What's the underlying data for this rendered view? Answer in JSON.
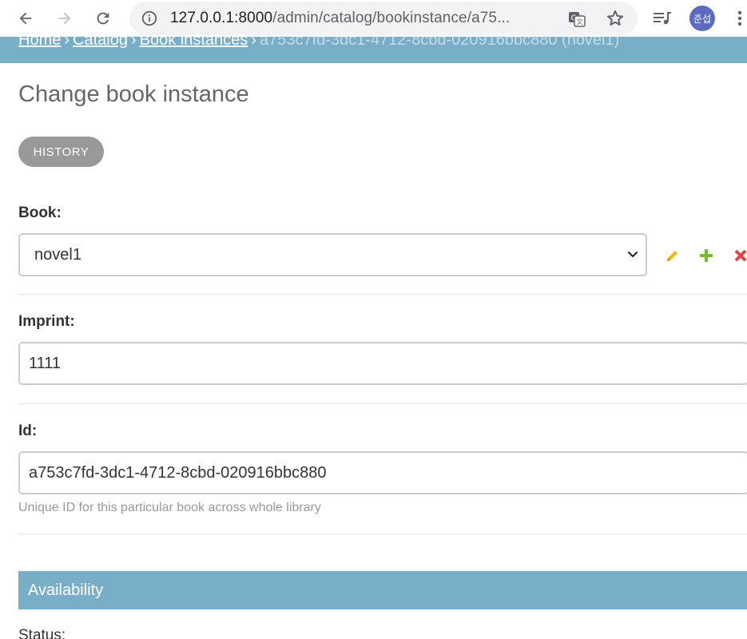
{
  "browser": {
    "url_host": "127.0.0.1:8000",
    "url_path": "/admin/catalog/bookinstance/a75...",
    "avatar_text": "준섭",
    "icons": [
      "back-arrow-icon",
      "forward-arrow-icon",
      "reload-icon",
      "info-icon",
      "translate-icon",
      "star-icon",
      "media-queue-icon",
      "more-vert-icon"
    ]
  },
  "breadcrumbs": {
    "home": "Home",
    "catalog": "Catalog",
    "book_instances": "Book instances",
    "current": "a753c7fd-3dc1-4712-8cbd-020916bbc880 (novel1)",
    "separator": "›"
  },
  "page": {
    "title": "Change book instance",
    "history_button": "HISTORY"
  },
  "form": {
    "book": {
      "label": "Book:",
      "value": "novel1"
    },
    "imprint": {
      "label": "Imprint:",
      "value": "1111"
    },
    "id": {
      "label": "Id:",
      "value": "a753c7fd-3dc1-4712-8cbd-020916bbc880",
      "help": "Unique ID for this particular book across whole library"
    }
  },
  "availability": {
    "header": "Availability",
    "status_label": "Status:"
  },
  "colors": {
    "accent": "#79aec8",
    "history_button": "#999999",
    "edit_icon": "#efb80b",
    "add_icon": "#70bf2b",
    "delete_icon": "#dd4646"
  }
}
